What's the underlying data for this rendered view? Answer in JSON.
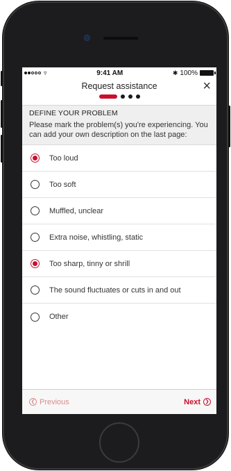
{
  "statusbar": {
    "signal_bars": 5,
    "signal_filled": 2,
    "wifi_icon": "wifi-icon",
    "time": "9:41 AM",
    "bluetooth_icon": "bluetooth-icon",
    "battery_text": "100%"
  },
  "nav": {
    "title": "Request assistance",
    "close_icon": "×",
    "progress_steps": 4,
    "progress_current": 1
  },
  "intro": {
    "section_title": "DEFINE YOUR PROBLEM",
    "instructions": "Please mark the problem(s) you're experiencing. You can add your own description on the last page:"
  },
  "options": [
    {
      "label": "Too loud",
      "checked": true
    },
    {
      "label": "Too soft",
      "checked": false
    },
    {
      "label": "Muffled, unclear",
      "checked": false
    },
    {
      "label": "Extra noise, whistling, static",
      "checked": false
    },
    {
      "label": "Too sharp, tinny or shrill",
      "checked": true
    },
    {
      "label": "The sound fluctuates or cuts in and out",
      "checked": false
    },
    {
      "label": "Other",
      "checked": false
    }
  ],
  "footer": {
    "previous_label": "Previous",
    "next_label": "Next"
  },
  "colors": {
    "accent": "#c8102e",
    "accent_disabled": "#d98c8c",
    "intro_bg": "#efefef"
  }
}
